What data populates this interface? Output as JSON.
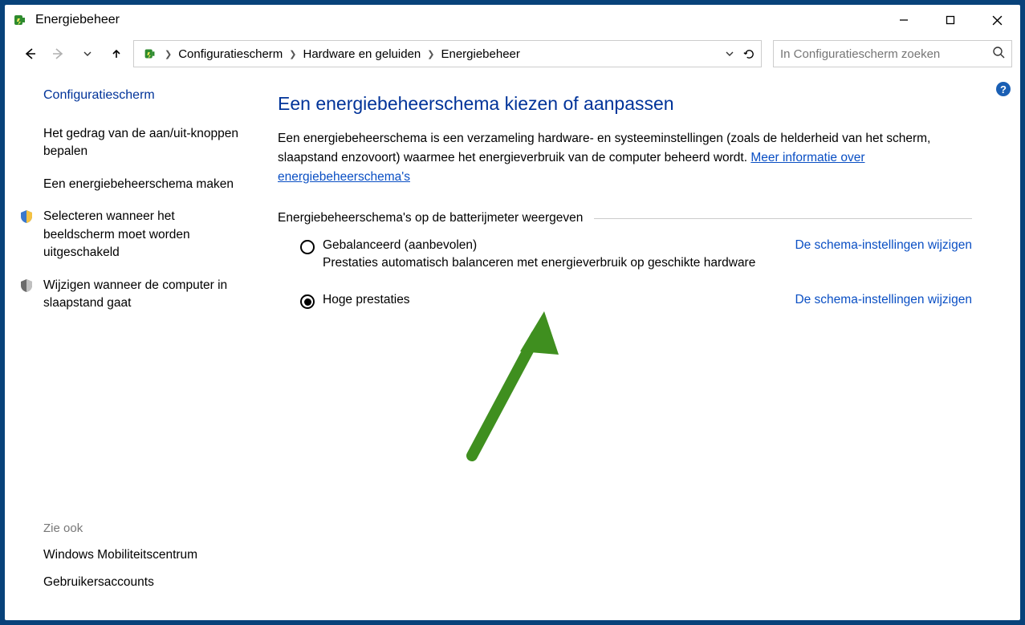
{
  "window": {
    "title": "Energiebeheer"
  },
  "breadcrumbs": {
    "items": [
      "Configuratiescherm",
      "Hardware en geluiden",
      "Energiebeheer"
    ]
  },
  "search": {
    "placeholder": "In Configuratiescherm zoeken"
  },
  "sidebar": {
    "home": "Configuratiescherm",
    "links": [
      "Het gedrag van de aan/uit-knoppen bepalen",
      "Een energiebeheerschema maken",
      "Selecteren wanneer het beeldscherm moet worden uitgeschakeld",
      "Wijzigen wanneer de computer in slaapstand gaat"
    ],
    "see_also_hdr": "Zie ook",
    "see_also_links": [
      "Windows Mobiliteitscentrum",
      "Gebruikersaccounts"
    ]
  },
  "main": {
    "heading": "Een energiebeheerschema kiezen of aanpassen",
    "desc_pre": "Een energiebeheerschema is een verzameling hardware- en systeeminstellingen (zoals de helderheid van het scherm, slaapstand enzovoort) waarmee het energieverbruik van de computer beheerd wordt. ",
    "desc_link": "Meer informatie over energiebeheerschema's",
    "group_hdr": "Energiebeheerschema's op de batterijmeter weergeven",
    "change_link": "De schema-instellingen wijzigen",
    "plans": [
      {
        "name": "Gebalanceerd (aanbevolen)",
        "desc": "Prestaties automatisch balanceren met energieverbruik op geschikte hardware",
        "selected": false
      },
      {
        "name": "Hoge prestaties",
        "desc": "",
        "selected": true
      }
    ]
  },
  "help_label": "?"
}
